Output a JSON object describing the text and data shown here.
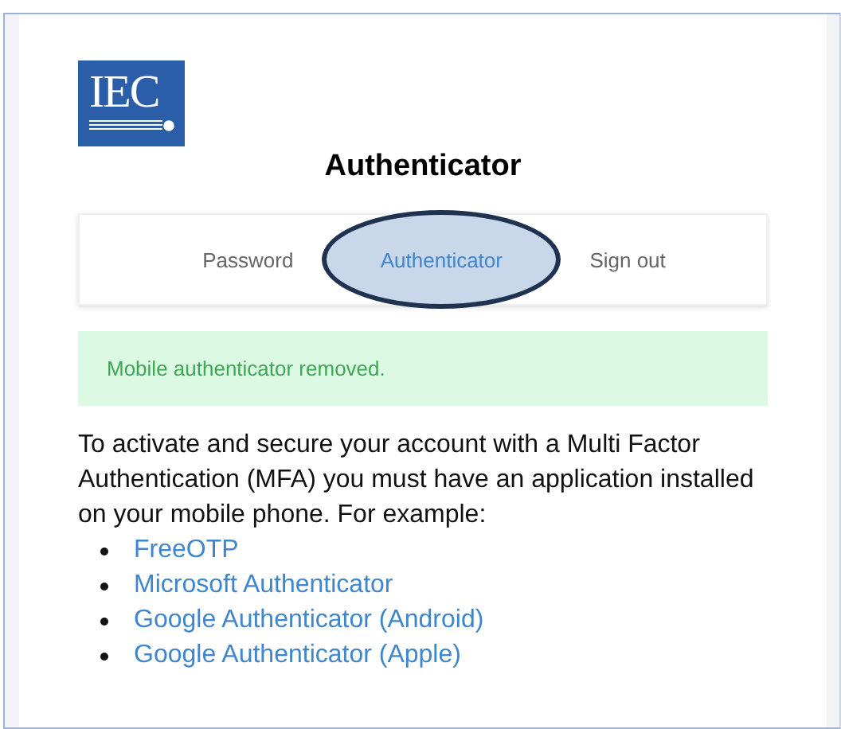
{
  "logo": {
    "text": "IEC"
  },
  "title": "Authenticator",
  "tabs": [
    {
      "label": "Password",
      "selected": false
    },
    {
      "label": "Authenticator",
      "selected": true
    },
    {
      "label": "Sign out",
      "selected": false
    }
  ],
  "alert": {
    "kind": "success",
    "message": "Mobile authenticator removed."
  },
  "intro": "To activate and secure your account with a Multi Factor Authentication (MFA) you must have an application installed on your mobile phone. For example:",
  "apps": [
    "FreeOTP",
    "Microsoft Authenticator",
    "Google Authenticator (Android)",
    "Google Authenticator (Apple)"
  ]
}
